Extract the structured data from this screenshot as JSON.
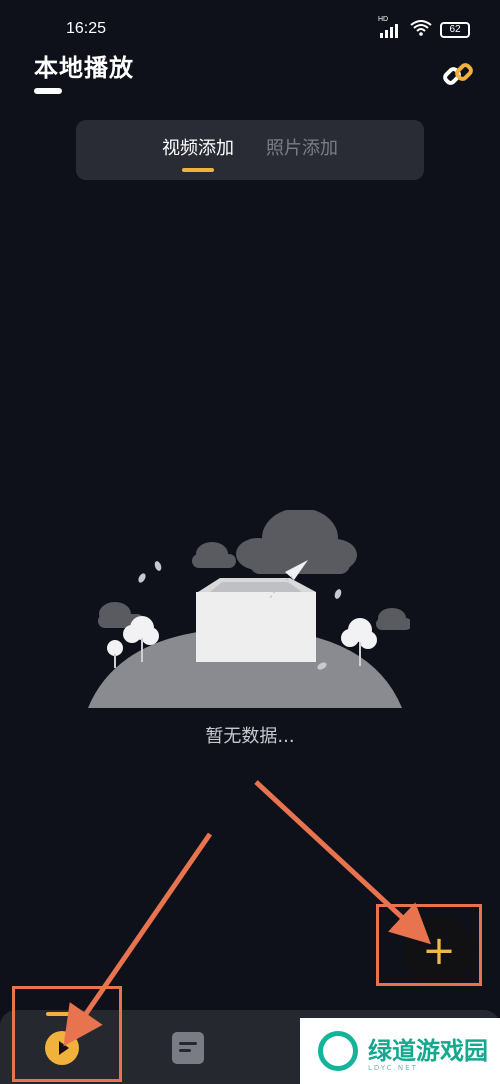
{
  "status_bar": {
    "time": "16:25",
    "battery": "62",
    "network_badge": "HD"
  },
  "header": {
    "title": "本地播放",
    "link_icon": "link-icon"
  },
  "tabs": [
    {
      "label": "视频添加",
      "active": true
    },
    {
      "label": "照片添加",
      "active": false
    }
  ],
  "empty_state": {
    "message": "暂无数据..."
  },
  "fab": {
    "label": "+"
  },
  "bottom_nav": {
    "items": [
      {
        "icon": "play-icon",
        "active": true
      },
      {
        "icon": "notes-icon",
        "active": false
      },
      {
        "icon": "star-icon",
        "active": false
      },
      {
        "icon": "user-icon",
        "active": false
      }
    ]
  },
  "watermark": {
    "text": "绿道游戏园",
    "sub": "LDYC.NET"
  },
  "colors": {
    "background": "#0f111a",
    "accent": "#f0b23c",
    "annotation": "#e8734f"
  }
}
